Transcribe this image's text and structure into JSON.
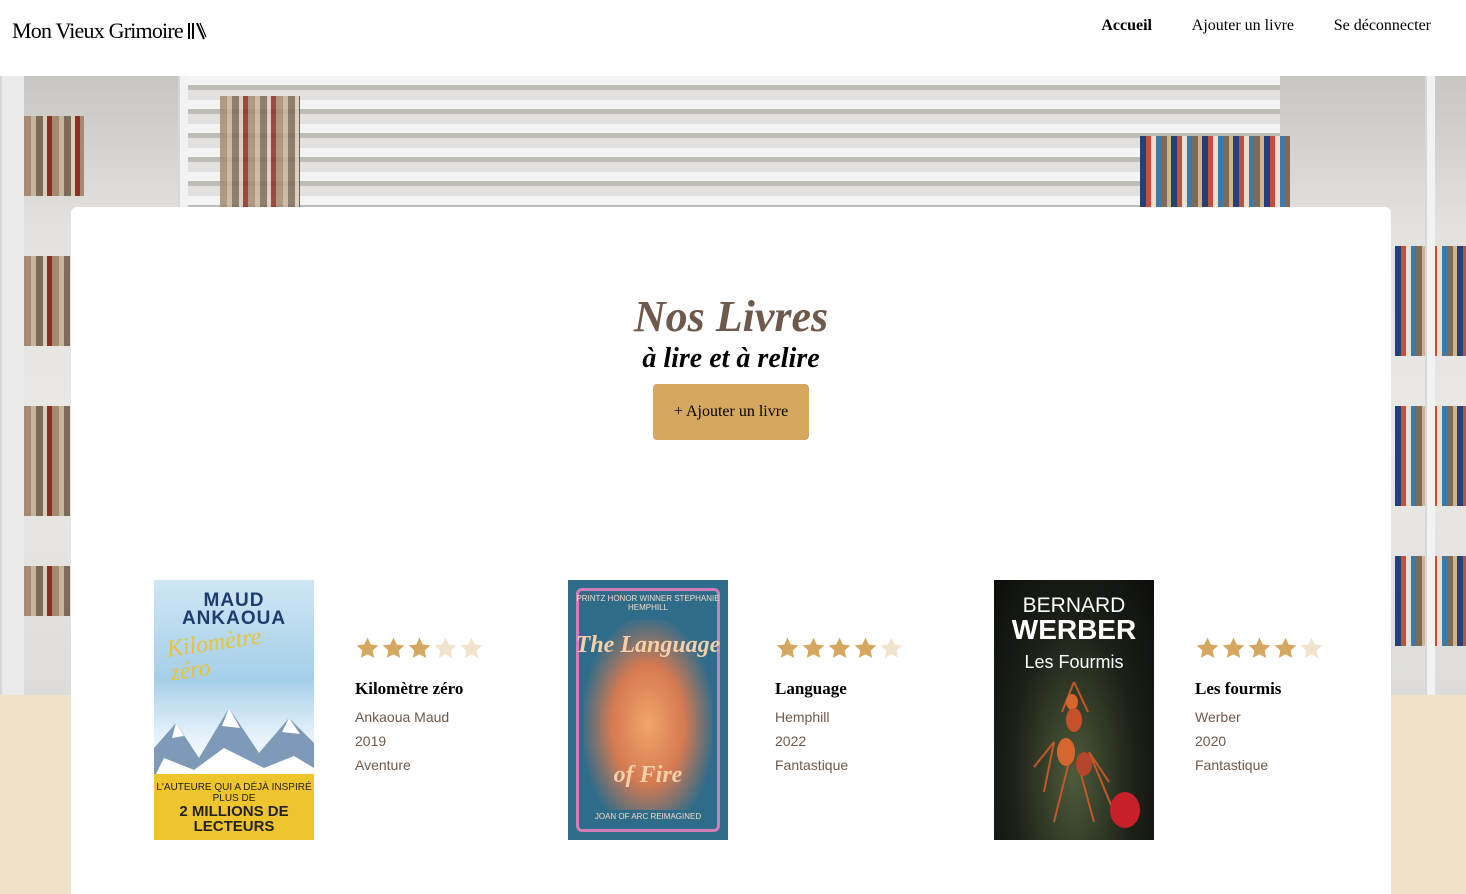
{
  "header": {
    "logo_text": "Mon Vieux Grimoire",
    "logo_icon": "books-icon",
    "nav": [
      {
        "label": "Accueil",
        "active": true
      },
      {
        "label": "Ajouter un livre",
        "active": false
      },
      {
        "label": "Se déconnecter",
        "active": false
      }
    ]
  },
  "main": {
    "title": "Nos Livres",
    "subtitle": "à lire et à relire",
    "add_button_label": "+ Ajouter un livre"
  },
  "colors": {
    "accent": "#d6a75e",
    "title": "#6e5a4c",
    "meta_text": "#6e5a4c",
    "star_filled": "#d6a75e",
    "star_empty": "#f2e3cc",
    "band": "#f0e1cb"
  },
  "books": [
    {
      "title": "Kilomètre zéro",
      "author": "Ankaoua Maud",
      "year": "2019",
      "genre": "Aventure",
      "rating": 3,
      "cover": {
        "author_line1": "MAUD",
        "author_line2": "ANKAOUA",
        "title_script": "Kilomètre zéro",
        "banner_small": "L'AUTEURE QUI A DÉJÀ INSPIRÉ PLUS DE",
        "banner_big": "2 MILLIONS DE LECTEURS"
      }
    },
    {
      "title": "Language",
      "author": "Hemphill",
      "year": "2022",
      "genre": "Fantastique",
      "rating": 4,
      "cover": {
        "top_text": "PRINTZ HONOR WINNER STEPHANIE HEMPHILL",
        "title_top": "The Language",
        "title_bottom": "of Fire",
        "bottom_text": "JOAN OF ARC REIMAGINED"
      }
    },
    {
      "title": "Les fourmis",
      "author": "Werber",
      "year": "2020",
      "genre": "Fantastique",
      "rating": 4,
      "cover": {
        "author_line1": "BERNARD",
        "author_line2": "WERBER",
        "title": "Les Fourmis"
      }
    }
  ]
}
